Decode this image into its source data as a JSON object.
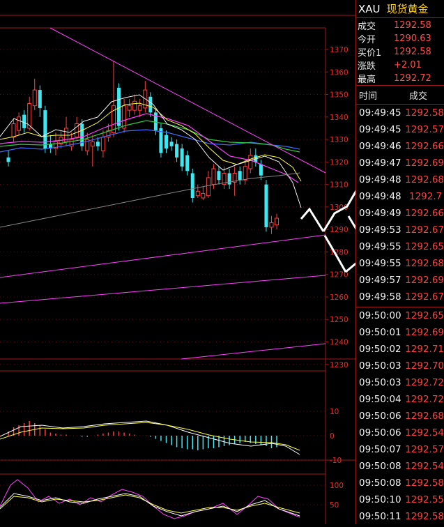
{
  "header": {
    "symbol": "XAU",
    "name": "现货黄金"
  },
  "quote": [
    {
      "label": "成交",
      "value": "1292.58"
    },
    {
      "label": "今开",
      "value": "1290.63"
    },
    {
      "label": "买价1",
      "value": "1292.58"
    },
    {
      "label": "涨跌",
      "value": "+2.01"
    },
    {
      "label": "最高",
      "value": "1292.72"
    }
  ],
  "ticks_header": {
    "time": "时间",
    "price": "成交"
  },
  "ticks": [
    {
      "time": "09:49:45",
      "price": "1292.58"
    },
    {
      "time": "09:49:45",
      "price": "1292.57"
    },
    {
      "time": "09:49:46",
      "price": "1292.66"
    },
    {
      "time": "09:49:47",
      "price": "1292.69"
    },
    {
      "time": "09:49:48",
      "price": "1292.68"
    },
    {
      "time": "09:49:48",
      "price": "1292.7"
    },
    {
      "time": "09:49:49",
      "price": "1292.66"
    },
    {
      "time": "09:49:53",
      "price": "1292.67"
    },
    {
      "time": "09:49:55",
      "price": "1292.65"
    },
    {
      "time": "09:49:55",
      "price": "1292.68"
    },
    {
      "time": "09:49:57",
      "price": "1292.69"
    },
    {
      "time": "09:49:58",
      "price": "1292.67"
    },
    {
      "time": "09:50:00",
      "price": "1292.65"
    },
    {
      "time": "09:50:01",
      "price": "1292.69"
    },
    {
      "time": "09:50:02",
      "price": "1292.71"
    },
    {
      "time": "09:50:03",
      "price": "1292.70"
    },
    {
      "time": "09:50:03",
      "price": "1292.72"
    },
    {
      "time": "09:50:04",
      "price": "1292.72"
    },
    {
      "time": "09:50:06",
      "price": "1292.68"
    },
    {
      "time": "09:50:06",
      "price": "1292.54"
    },
    {
      "time": "09:50:07",
      "price": "1292.57"
    },
    {
      "time": "09:50:08",
      "price": "1292.54"
    },
    {
      "time": "09:50:08",
      "price": "1292.58"
    },
    {
      "time": "09:50:10",
      "price": "1292.55"
    },
    {
      "time": "09:50:11",
      "price": "1292.58"
    }
  ],
  "price_axis": [
    "1370",
    "1360",
    "1350",
    "1340",
    "1330",
    "1320",
    "1310",
    "1300",
    "1290",
    "1280",
    "1270",
    "1260",
    "1250",
    "1240",
    "1230"
  ],
  "macd_axis": [
    "10",
    "0",
    "-10"
  ],
  "kdj_axis": [
    "100",
    "50"
  ],
  "colors": {
    "up": "#ff4040",
    "down": "#3ee8f0",
    "border": "#a01818",
    "trend": "#ff40ff"
  }
}
